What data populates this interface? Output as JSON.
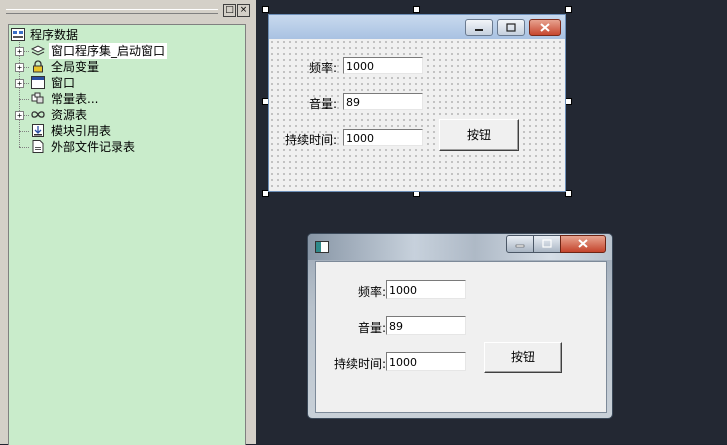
{
  "left_panel": {
    "header": {
      "restore_glyph": "□",
      "close_glyph": "×"
    },
    "tree": {
      "root": {
        "label": "程序数据",
        "icon": "program-data-icon"
      },
      "items": [
        {
          "label": "窗口程序集_启动窗口",
          "icon": "layers-icon",
          "expandable": true,
          "selected": true
        },
        {
          "label": "全局变量",
          "icon": "lock-icon",
          "expandable": true
        },
        {
          "label": "窗口",
          "icon": "window-icon",
          "expandable": true
        },
        {
          "label": "常量表...",
          "icon": "cubes-icon",
          "expandable": false
        },
        {
          "label": "资源表",
          "icon": "infinity-icon",
          "expandable": true
        },
        {
          "label": "模块引用表",
          "icon": "module-icon",
          "expandable": false
        },
        {
          "label": "外部文件记录表",
          "icon": "file-record-icon",
          "expandable": false
        }
      ],
      "expand_glyph": "+"
    }
  },
  "design_form": {
    "fields": [
      {
        "label": "频率:",
        "value": "1000"
      },
      {
        "label": "音量:",
        "value": "89"
      },
      {
        "label": "持续时间:",
        "value": "1000"
      }
    ],
    "button_label": "按钮"
  },
  "run_window": {
    "fields": [
      {
        "label": "频率:",
        "value": "1000"
      },
      {
        "label": "音量:",
        "value": "89"
      },
      {
        "label": "持续时间:",
        "value": "1000"
      }
    ],
    "button_label": "按钮"
  }
}
